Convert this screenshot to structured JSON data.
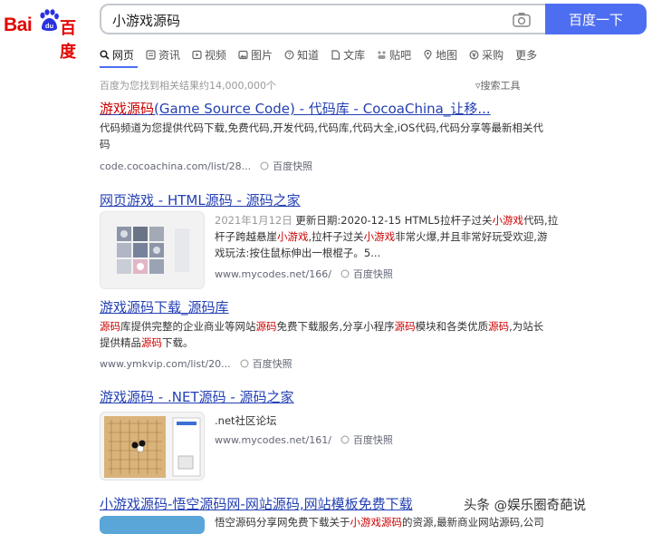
{
  "header": {
    "logo_latin": "Bai",
    "logo_paw": "du",
    "logo_cn": "百度",
    "query": "小游戏源码",
    "search_button": "百度一下"
  },
  "tabs": [
    {
      "label": "网页",
      "icon": "search-icon",
      "active": true
    },
    {
      "label": "资讯",
      "icon": "news-icon"
    },
    {
      "label": "视频",
      "icon": "video-icon"
    },
    {
      "label": "图片",
      "icon": "image-icon"
    },
    {
      "label": "知道",
      "icon": "question-icon"
    },
    {
      "label": "文库",
      "icon": "doc-icon"
    },
    {
      "label": "贴吧",
      "icon": "tieba-icon"
    },
    {
      "label": "地图",
      "icon": "map-icon"
    },
    {
      "label": "采购",
      "icon": "purchase-icon"
    },
    {
      "label": "更多",
      "icon": ""
    }
  ],
  "result_info": "百度为您找到相关结果约14,000,000个",
  "search_tools": "搜索工具",
  "results": [
    {
      "title_pre": "游戏源码",
      "title_post": "(Game Source Code) - 代码库 - CocoaChina_让移...",
      "desc_line1": "代码频道为您提供代码下载,免费代码,开发代码,代码库,代码大全,iOS代码,代码分享等最新相关代",
      "desc_line2": "码",
      "url": "code.cocoachina.com/list/28...",
      "snapshot": "百度快照"
    },
    {
      "title": "网页游戏 - HTML源码 - 源码之家",
      "date": "2021年1月12日",
      "desc_a": "更新日期:2020-12-15 HTML5拉杆子过关",
      "desc_em1": "小游戏",
      "desc_b": "代码,拉",
      "desc_c": "杆子跨越悬崖",
      "desc_em2": "小游戏",
      "desc_d": ",拉杆子过关",
      "desc_em3": "小游戏",
      "desc_e": "非常火爆,并且非常好玩受欢迎,游",
      "desc_f": "戏玩法:按住鼠标伸出一根棍子。5...",
      "url": "www.mycodes.net/166/",
      "snapshot": "百度快照"
    },
    {
      "title": "游戏源码下载_源码库",
      "desc_em1": "源码",
      "desc_a": "库提供完整的企业商业等网站",
      "desc_em2": "源码",
      "desc_b": "免费下载服务,分享小程序",
      "desc_em3": "源码",
      "desc_c": "模块和各类优质",
      "desc_em4": "源码",
      "desc_d": ",为站长",
      "desc_e": "提供精品",
      "desc_em5": "源码",
      "desc_f": "下载。",
      "url": "www.ymkvip.com/list/20...",
      "snapshot": "百度快照"
    },
    {
      "title": "游戏源码 - .NET源码 - 源码之家",
      "desc": ".net社区论坛",
      "url": "www.mycodes.net/161/",
      "snapshot": "百度快照"
    },
    {
      "title": "小游戏源码-悟空源码网-网站源码,网站模板免费下载",
      "desc_a": "悟空源码分享网免费下载关于",
      "desc_em": "小游戏源码",
      "desc_b": "的资源,最新商业网站源码,公司"
    }
  ],
  "watermark": "头条 @娱乐圈奇葩说",
  "colors": {
    "brand_red": "#e10602",
    "brand_blue": "#4e6ef2",
    "title_link": "#2440b3",
    "highlight": "#c00000"
  }
}
